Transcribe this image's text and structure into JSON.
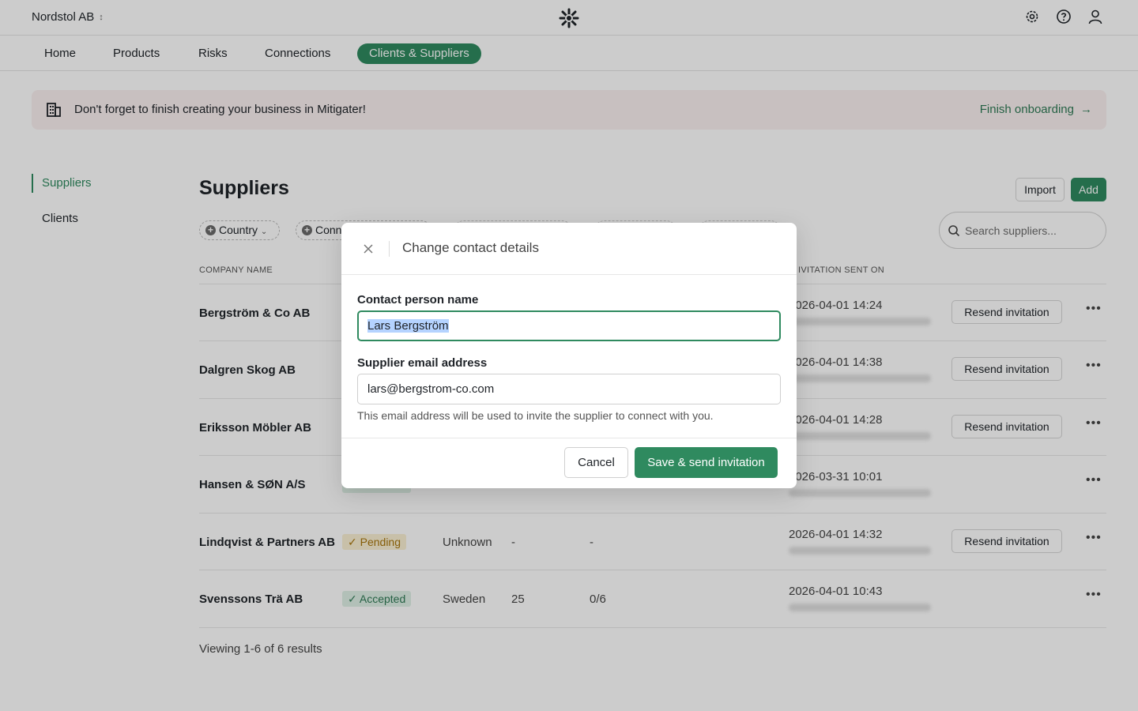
{
  "header": {
    "org_name": "Nordstol AB",
    "icons": [
      "gear-icon",
      "help-icon",
      "user-icon"
    ]
  },
  "nav": {
    "items": [
      "Home",
      "Products",
      "Risks",
      "Connections",
      "Clients & Suppliers"
    ],
    "active": "Clients & Suppliers"
  },
  "banner": {
    "text": "Don't forget to finish creating your business in Mitigater!",
    "link": "Finish onboarding"
  },
  "sidebar": {
    "items": [
      "Suppliers",
      "Clients"
    ],
    "active": "Suppliers"
  },
  "main": {
    "title": "Suppliers",
    "import_label": "Import",
    "add_label": "Add",
    "search_placeholder": "Search suppliers...",
    "filters": [
      "Country",
      "Conn"
    ],
    "columns": {
      "company": "COMPANY NAME",
      "invitation": "INVITATION SENT ON",
      "invitation_visible": "IVITATION SENT ON"
    },
    "rows": [
      {
        "company": "Bergström & Co AB",
        "status": "",
        "country": "",
        "num": "",
        "score": "",
        "date": "2026-04-01 14:24",
        "resend": "Resend invitation"
      },
      {
        "company": "Dalgren Skog AB",
        "status": "",
        "country": "",
        "num": "",
        "score": "",
        "date": "2026-04-01 14:38",
        "resend": "Resend invitation"
      },
      {
        "company": "Eriksson Möbler AB",
        "status": "",
        "country": "",
        "num": "",
        "score": "",
        "date": "2026-04-01 14:28",
        "resend": "Resend invitation"
      },
      {
        "company": "Hansen & SØN A/S",
        "status": "",
        "country": "",
        "num": "",
        "score": "",
        "date": "2026-03-31 10:01",
        "resend": ""
      },
      {
        "company": "Lindqvist & Partners AB",
        "status": "Pending",
        "country": "Unknown",
        "num": "-",
        "score": "-",
        "date": "2026-04-01 14:32",
        "resend": "Resend invitation"
      },
      {
        "company": "Svenssons Trä AB",
        "status": "Accepted",
        "country": "Sweden",
        "num": "25",
        "score": "0/6",
        "date": "2026-04-01 10:43",
        "resend": ""
      }
    ],
    "footer": "Viewing 1-6 of 6 results"
  },
  "modal": {
    "title": "Change contact details",
    "name_label": "Contact person name",
    "name_value": "Lars Bergström",
    "email_label": "Supplier email address",
    "email_value": "lars@bergstrom-co.com",
    "help": "This email address will be used to invite the supplier to connect with you.",
    "cancel": "Cancel",
    "save": "Save & send invitation"
  },
  "colors": {
    "accent": "#2f8a5f",
    "banner_bg": "#fbf1f1",
    "pending_bg": "#fbf0d4",
    "accepted_bg": "#dff1e6"
  }
}
